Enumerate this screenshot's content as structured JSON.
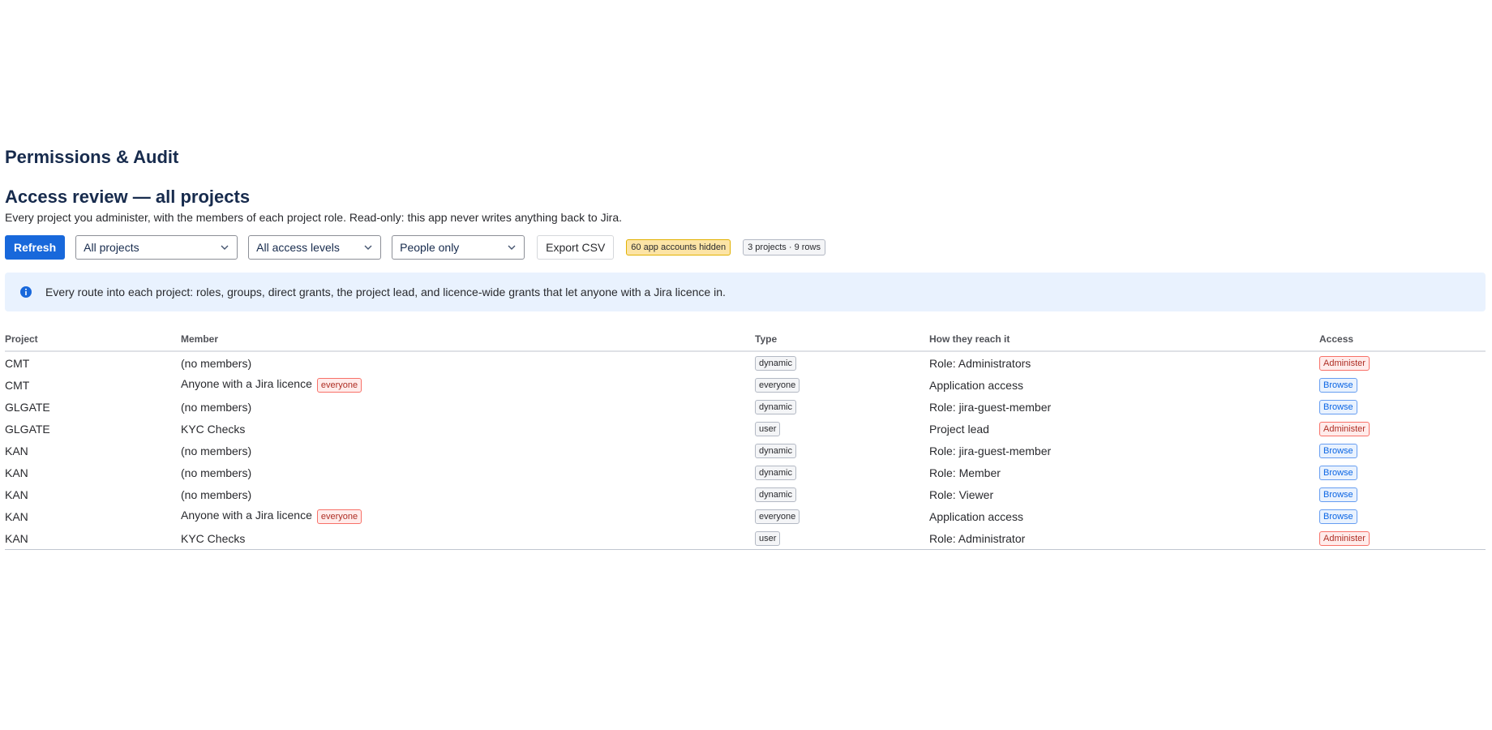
{
  "app": {
    "title": "Permissions & Audit"
  },
  "section": {
    "title": "Access review — all projects",
    "description": "Every project you administer, with the members of each project role. Read-only: this app never writes anything back to Jira."
  },
  "toolbar": {
    "refresh_label": "Refresh",
    "project_filter": "All projects",
    "access_filter": "All access levels",
    "people_filter": "People only",
    "export_label": "Export CSV",
    "hidden_badge": "60 app accounts hidden",
    "count_badge": "3 projects · 9 rows"
  },
  "banner": {
    "icon": "info-icon",
    "text": "Every route into each project: roles, groups, direct grants, the project lead, and licence-wide grants that let anyone with a Jira licence in."
  },
  "table": {
    "columns": [
      "Project",
      "Member",
      "Type",
      "How they reach it",
      "Access"
    ],
    "rows": [
      {
        "project": "CMT",
        "member": "(no members)",
        "member_flag": "",
        "type": "dynamic",
        "how": "Role: Administrators",
        "access": "Administer"
      },
      {
        "project": "CMT",
        "member": "Anyone with a Jira licence",
        "member_flag": "everyone",
        "type": "everyone",
        "how": "Application access",
        "access": "Browse"
      },
      {
        "project": "GLGATE",
        "member": "(no members)",
        "member_flag": "",
        "type": "dynamic",
        "how": "Role: jira-guest-member",
        "access": "Browse"
      },
      {
        "project": "GLGATE",
        "member": "KYC Checks",
        "member_flag": "",
        "type": "user",
        "how": "Project lead",
        "access": "Administer"
      },
      {
        "project": "KAN",
        "member": "(no members)",
        "member_flag": "",
        "type": "dynamic",
        "how": "Role: jira-guest-member",
        "access": "Browse"
      },
      {
        "project": "KAN",
        "member": "(no members)",
        "member_flag": "",
        "type": "dynamic",
        "how": "Role: Member",
        "access": "Browse"
      },
      {
        "project": "KAN",
        "member": "(no members)",
        "member_flag": "",
        "type": "dynamic",
        "how": "Role: Viewer",
        "access": "Browse"
      },
      {
        "project": "KAN",
        "member": "Anyone with a Jira licence",
        "member_flag": "everyone",
        "type": "everyone",
        "how": "Application access",
        "access": "Browse"
      },
      {
        "project": "KAN",
        "member": "KYC Checks",
        "member_flag": "",
        "type": "user",
        "how": "Role: Administrator",
        "access": "Administer"
      }
    ]
  },
  "colors": {
    "primary": "#1868db",
    "banner_bg": "#e9f2fe",
    "warn_bg": "#fce4a6",
    "administer": "#ae2e24",
    "browse": "#0c66e4"
  }
}
